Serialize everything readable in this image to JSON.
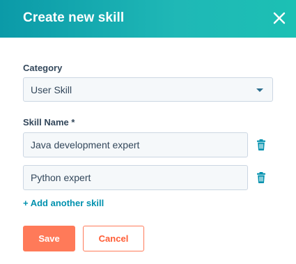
{
  "modal": {
    "title": "Create new skill",
    "close_icon": "close-icon"
  },
  "form": {
    "category": {
      "label": "Category",
      "selected": "User Skill",
      "dropdown_icon": "caret-down-icon"
    },
    "skill_name": {
      "label": "Skill Name *",
      "entries": [
        {
          "value": "Java development expert",
          "delete_icon": "trash-icon"
        },
        {
          "value": "Python expert",
          "delete_icon": "trash-icon"
        }
      ]
    },
    "add_link": "+ Add another skill"
  },
  "actions": {
    "save_label": "Save",
    "cancel_label": "Cancel"
  },
  "colors": {
    "header_gradient_start": "#0b9aa8",
    "header_gradient_end": "#1cc0b4",
    "primary_button": "#ff7a59",
    "link": "#0091ae",
    "text": "#33475b"
  }
}
